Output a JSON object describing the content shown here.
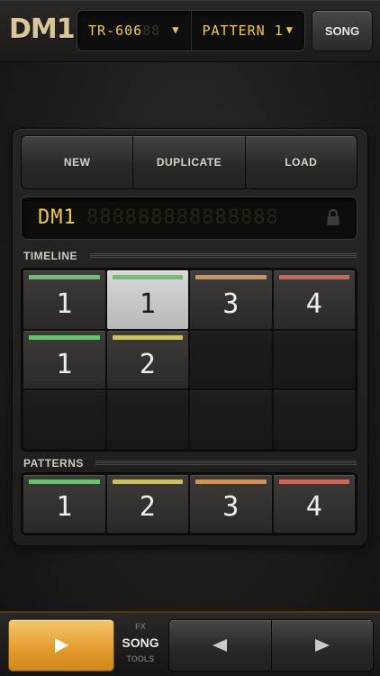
{
  "header": {
    "logo": "DM1",
    "kit_selector": {
      "value": "TR-606",
      "ghost": "88"
    },
    "pattern_selector": {
      "value": "PATTERN 1"
    },
    "song_label": "SONG"
  },
  "actions": {
    "new_label": "NEW",
    "duplicate_label": "DUPLICATE",
    "load_label": "LOAD"
  },
  "display": {
    "text": "DM1",
    "ghost": "888888888888888"
  },
  "timeline": {
    "label": "TIMELINE",
    "cells": [
      {
        "num": "1",
        "color": "#6fbf73",
        "selected": false
      },
      {
        "num": "1",
        "color": "#6fbf73",
        "selected": true
      },
      {
        "num": "3",
        "color": "#c9955a",
        "selected": false
      },
      {
        "num": "4",
        "color": "#c96a5a",
        "selected": false
      },
      {
        "num": "1",
        "color": "#6fbf73",
        "selected": false
      },
      {
        "num": "2",
        "color": "#c9c06a",
        "selected": false
      }
    ]
  },
  "patterns": {
    "label": "PATTERNS",
    "cells": [
      {
        "num": "1",
        "color": "#6fbf73"
      },
      {
        "num": "2",
        "color": "#c9c06a"
      },
      {
        "num": "3",
        "color": "#c9955a"
      },
      {
        "num": "4",
        "color": "#c96a5a"
      }
    ]
  },
  "transport": {
    "mode_fx": "FX",
    "mode_song": "SONG",
    "mode_tools": "TOOLS"
  },
  "colors": {
    "accent": "#f2c94c",
    "play": "#e29a2c"
  }
}
